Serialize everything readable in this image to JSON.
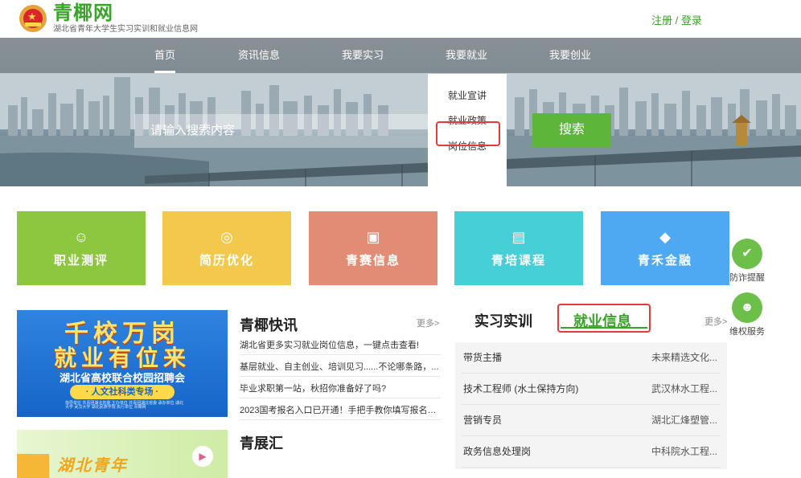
{
  "header": {
    "title": "青椰网",
    "subtitle": "湖北省青年大学生实习实训和就业信息网",
    "register": "注册",
    "separator": " / ",
    "login": "登录"
  },
  "nav": {
    "items": [
      "首页",
      "资讯信息",
      "我要实习",
      "我要就业",
      "我要创业"
    ],
    "active": "首页"
  },
  "dropdown": {
    "items": [
      "就业宣讲",
      "就业政策",
      "岗位信息"
    ]
  },
  "search": {
    "placeholder": "请输入搜索内容",
    "button": "搜索"
  },
  "tiles": [
    {
      "label": "职业测评",
      "icon": "smile-icon",
      "color": "#8dc63f"
    },
    {
      "label": "简历优化",
      "icon": "medal-icon",
      "color": "#f2c94c"
    },
    {
      "label": "青赛信息",
      "icon": "id-card-icon",
      "color": "#e28b75"
    },
    {
      "label": "青培课程",
      "icon": "calendar-icon",
      "color": "#46cfd6"
    },
    {
      "label": "青禾金融",
      "icon": "diamond-icon",
      "color": "#4ea8f2"
    }
  ],
  "side": {
    "fraud": "防诈提醒",
    "rights": "维权服务"
  },
  "banner1": {
    "line1": "千校万岗",
    "line2": "就业有位来",
    "sub": "湖北省高校联合校园招聘会",
    "pill": "· 人文社科类专场 ·",
    "small": "指导单位 共青团湖北省委 主办单位 共青团湖北省委 承办单位 湖北大学 武汉大学 湖北民族学院 执行单位 青椰网"
  },
  "banner2": {
    "text": "湖北青年"
  },
  "news": {
    "title": "青椰快讯",
    "more": "更多>",
    "items": [
      "湖北省更多实习就业岗位信息，一键点击查看!",
      "基层就业、自主创业、培训见习......不论哪条路，...",
      "毕业求职第一站，秋招你准备好了吗?",
      "2023国考报名入口已开通！手把手教你填写报名信..."
    ],
    "title2": "青展汇"
  },
  "jobs": {
    "tab1": "实习实训",
    "tab2": "就业信息",
    "more": "更多>",
    "items": [
      {
        "title": "带货主播",
        "company": "未来精选文化..."
      },
      {
        "title": "技术工程师 (水土保持方向)",
        "company": "武汉林水工程..."
      },
      {
        "title": "营销专员",
        "company": "湖北汇烽塑管..."
      },
      {
        "title": "政务信息处理岗",
        "company": "中科院水工程..."
      }
    ]
  }
}
